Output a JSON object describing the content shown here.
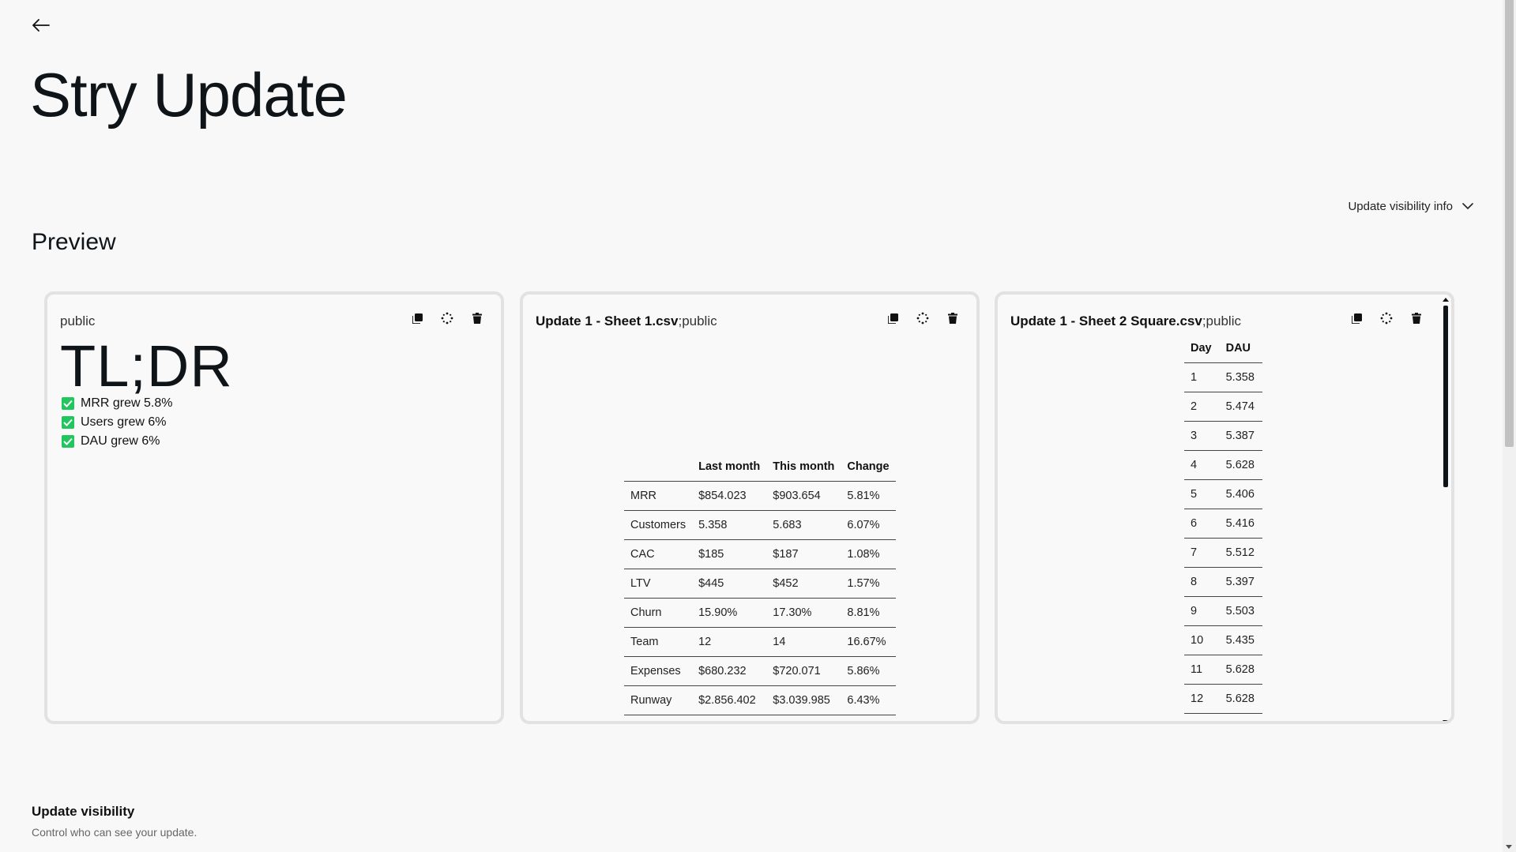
{
  "page": {
    "title": "Stry Update",
    "back_icon": "arrow-left-icon"
  },
  "visibility_toggle": {
    "label": "Update visibility info",
    "icon": "chevron-down-icon"
  },
  "preview": {
    "title": "Preview",
    "cards": [
      {
        "title": "",
        "visibility": "public",
        "heading": "TL;DR",
        "checklist": [
          {
            "label": "MRR grew 5.8%",
            "checked": true
          },
          {
            "label": "Users grew 6%",
            "checked": true
          },
          {
            "label": "DAU grew 6%",
            "checked": true
          }
        ]
      },
      {
        "title": "Update 1 - Sheet 1.csv",
        "visibility": ";public",
        "table": {
          "headers": [
            "",
            "Last month",
            "This month",
            "Change"
          ],
          "rows": [
            [
              "MRR",
              "$854.023",
              "$903.654",
              "5.81%"
            ],
            [
              "Customers",
              "5.358",
              "5.683",
              "6.07%"
            ],
            [
              "CAC",
              "$185",
              "$187",
              "1.08%"
            ],
            [
              "LTV",
              "$445",
              "$452",
              "1.57%"
            ],
            [
              "Churn",
              "15.90%",
              "17.30%",
              "8.81%"
            ],
            [
              "Team",
              "12",
              "14",
              "16.67%"
            ],
            [
              "Expenses",
              "$680.232",
              "$720.071",
              "5.86%"
            ],
            [
              "Runway",
              "$2.856.402",
              "$3.039.985",
              "6.43%"
            ]
          ]
        }
      },
      {
        "title": "Update 1 - Sheet 2 Square.csv",
        "visibility": ";public",
        "table": {
          "headers": [
            "Day",
            "DAU"
          ],
          "rows": [
            [
              "1",
              "5.358"
            ],
            [
              "2",
              "5.474"
            ],
            [
              "3",
              "5.387"
            ],
            [
              "4",
              "5.628"
            ],
            [
              "5",
              "5.406"
            ],
            [
              "6",
              "5.416"
            ],
            [
              "7",
              "5.512"
            ],
            [
              "8",
              "5.397"
            ],
            [
              "9",
              "5.503"
            ],
            [
              "10",
              "5.435"
            ],
            [
              "11",
              "5.628"
            ],
            [
              "12",
              "5.628"
            ]
          ]
        }
      }
    ],
    "card_actions": {
      "copy_icon": "copy-icon",
      "move_icon": "drag-move-icon",
      "delete_icon": "trash-icon"
    }
  },
  "update_visibility": {
    "title": "Update visibility",
    "subtitle": "Control who can see your update."
  }
}
